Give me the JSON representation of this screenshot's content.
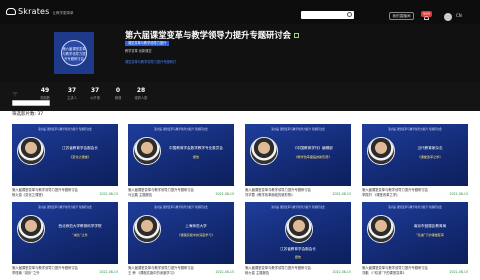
{
  "brand": {
    "name": "Skrates",
    "sub": "让教学更简单"
  },
  "topbar": {
    "my_button": "我的直播间",
    "badge": "999",
    "lang": "CN"
  },
  "hero": {
    "cover_text": "第六届课堂变革与教学领导力提升专题研讨会",
    "title": "第六届课堂变革与教学领导力提升专题研讨会",
    "tag": "课堂变革与教学领导力提升",
    "subline": "教学变革 创新课堂",
    "blue_line": "课堂变革与教学领导力提升专题研讨"
  },
  "stats": [
    {
      "value": "49",
      "label": "视频数"
    },
    {
      "value": "37",
      "label": "主讲人"
    },
    {
      "value": "37",
      "label": "公开课"
    },
    {
      "value": "0",
      "label": "微课"
    },
    {
      "value": "28",
      "label": "观看人数"
    }
  ],
  "filter": {
    "count_label": "筛选影片数: 37"
  },
  "cards": [
    {
      "head": "第六届 课堂变革与教学领导力提升 专题研讨会",
      "name": "江苏省教育学会副会长",
      "topic": "《变化之课堂》",
      "line1": "第六届课堂变革与教学领导力提升专题研讨会",
      "line2": "杨九俊《变化之课堂》",
      "date": "2022-08-15"
    },
    {
      "head": "第六届 课堂变革与教学领导力提升 专题研讨会",
      "name": "中国教育学会数学教学专业委员会",
      "topic": "报告",
      "line1": "第六届课堂变革与教学领导力提升专题研讨会",
      "line2": "马云鹏 主题报告",
      "date": "2022-08-15"
    },
    {
      "head": "第六届 课堂变革与教学领导力提升 专题研讨会",
      "name": "《中国教育学刊》编辑部",
      "topic": "《教学改革面临的新形势》",
      "line1": "第六届课堂变革与教学领导力提升专题研讨会",
      "line2": "刘华蓉《教学改革面临的新形势》",
      "date": "2022-08-15"
    },
    {
      "head": "第六届 课堂变革与教学领导力提升 专题研讨会",
      "name": "当代教育家杂志",
      "topic": "《课堂改革之学》",
      "line1": "第六届课堂变革与教学领导力提升专题研讨会",
      "line2": "李振村 《课堂改革之学》",
      "date": "2022-08-15"
    },
    {
      "head": "第六届 课堂变革与教学领导力提升 专题研讨会",
      "name": "西北师范大学教育科学学院",
      "topic": "“减负”之外",
      "line1": "第六届课堂变革与教学领导力提升专题研讨会",
      "line2": "李瑾瑜 “减负”之外",
      "date": "2022-08-15"
    },
    {
      "head": "第六届 课堂变革与教学领导力提升 专题研讨会",
      "name": "上海师范大学",
      "topic": "《课程实施中的深度学习》",
      "line1": "第六届课堂变革与教学领导力提升专题研讨会",
      "line2": "王 荣 《课程实施中的深度学习》",
      "date": "2022-08-15"
    },
    {
      "head": "第六届 课堂变革与教学领导力提升 专题研讨会",
      "name": "江苏省教育学会副会长",
      "topic": "报告",
      "line1": "第六届课堂变革与教学领导力提升专题研讨会",
      "line2": "杨九俊 主题报告",
      "date": "2022-08-15"
    },
    {
      "head": "第六届 课堂变革与教学领导力提升 专题研讨会",
      "name": "南京市鼓楼区教育局",
      "topic": "“双减”下的课堂变革",
      "line1": "第六届课堂变革与教学领导力提升专题研讨会",
      "line2": "刘鹏 《“双减”下的课堂变革》",
      "date": "2022-08-15"
    }
  ]
}
